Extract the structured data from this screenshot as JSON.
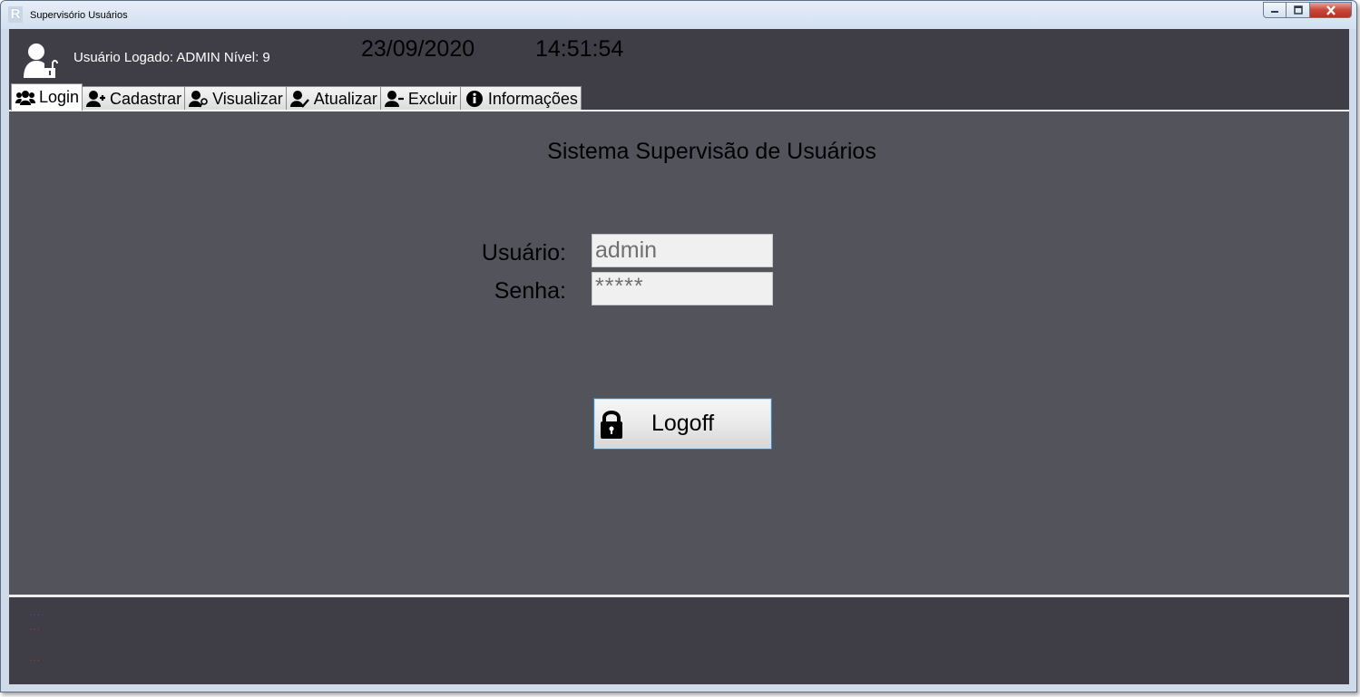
{
  "window": {
    "title": "Supervisório Usuários",
    "app_icon_letter": "R",
    "controls": {
      "minimize": "▭",
      "maximize": "□",
      "close": "✕"
    }
  },
  "header": {
    "logged_user": "Usuário Logado: ADMIN Nível: 9",
    "date": "23/09/2020",
    "time": "14:51:54",
    "avatar_icon": "user-unlock-icon"
  },
  "tabs": [
    {
      "label": "Login",
      "icon": "users-icon",
      "active": true
    },
    {
      "label": "Cadastrar",
      "icon": "user-add-icon"
    },
    {
      "label": "Visualizar",
      "icon": "user-search-icon"
    },
    {
      "label": "Atualizar",
      "icon": "user-edit-icon"
    },
    {
      "label": "Excluir",
      "icon": "user-remove-icon"
    },
    {
      "label": "Informações",
      "icon": "info-icon"
    }
  ],
  "login": {
    "title": "Sistema Supervisão de Usuários",
    "user_label": "Usuário:",
    "user_value": "admin",
    "password_label": "Senha:",
    "password_value": "*****",
    "logoff_label": "Logoff",
    "logoff_icon": "lock-icon"
  },
  "footer": {
    "markers": [
      "....",
      "...",
      "..."
    ]
  },
  "colors": {
    "window_frame": "#cfdbe9",
    "header_bg": "#3f3e46",
    "panel_bg": "#53535c",
    "field_bg": "#f0f0f0",
    "button_border": "#3c7fb1"
  }
}
